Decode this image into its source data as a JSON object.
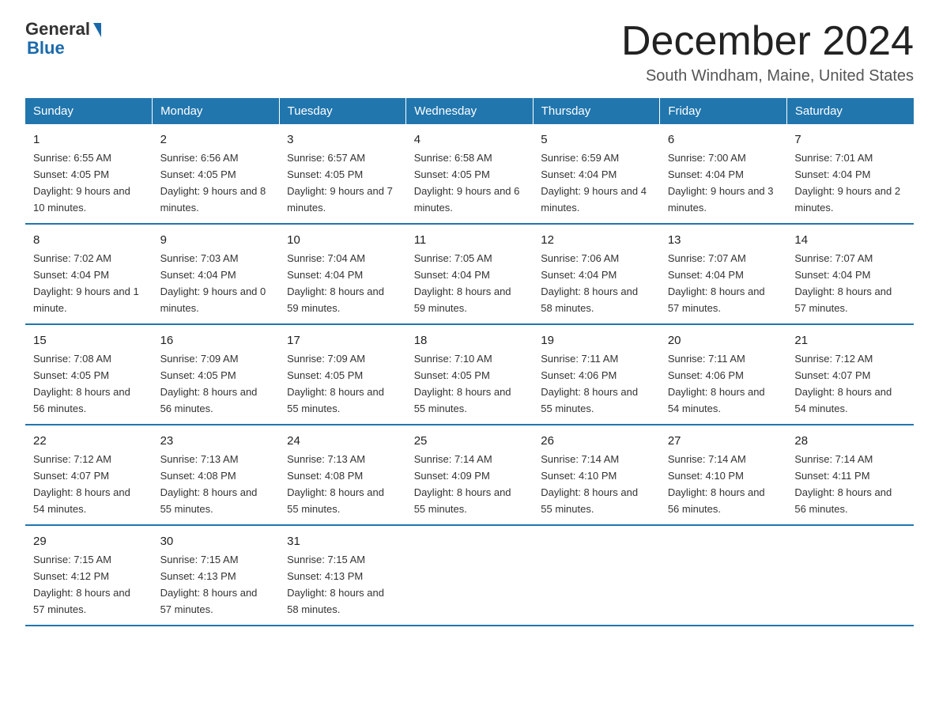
{
  "logo": {
    "general": "General",
    "blue": "Blue"
  },
  "title": "December 2024",
  "location": "South Windham, Maine, United States",
  "days_of_week": [
    "Sunday",
    "Monday",
    "Tuesday",
    "Wednesday",
    "Thursday",
    "Friday",
    "Saturday"
  ],
  "weeks": [
    [
      {
        "day": "1",
        "sunrise": "Sunrise: 6:55 AM",
        "sunset": "Sunset: 4:05 PM",
        "daylight": "Daylight: 9 hours and 10 minutes."
      },
      {
        "day": "2",
        "sunrise": "Sunrise: 6:56 AM",
        "sunset": "Sunset: 4:05 PM",
        "daylight": "Daylight: 9 hours and 8 minutes."
      },
      {
        "day": "3",
        "sunrise": "Sunrise: 6:57 AM",
        "sunset": "Sunset: 4:05 PM",
        "daylight": "Daylight: 9 hours and 7 minutes."
      },
      {
        "day": "4",
        "sunrise": "Sunrise: 6:58 AM",
        "sunset": "Sunset: 4:05 PM",
        "daylight": "Daylight: 9 hours and 6 minutes."
      },
      {
        "day": "5",
        "sunrise": "Sunrise: 6:59 AM",
        "sunset": "Sunset: 4:04 PM",
        "daylight": "Daylight: 9 hours and 4 minutes."
      },
      {
        "day": "6",
        "sunrise": "Sunrise: 7:00 AM",
        "sunset": "Sunset: 4:04 PM",
        "daylight": "Daylight: 9 hours and 3 minutes."
      },
      {
        "day": "7",
        "sunrise": "Sunrise: 7:01 AM",
        "sunset": "Sunset: 4:04 PM",
        "daylight": "Daylight: 9 hours and 2 minutes."
      }
    ],
    [
      {
        "day": "8",
        "sunrise": "Sunrise: 7:02 AM",
        "sunset": "Sunset: 4:04 PM",
        "daylight": "Daylight: 9 hours and 1 minute."
      },
      {
        "day": "9",
        "sunrise": "Sunrise: 7:03 AM",
        "sunset": "Sunset: 4:04 PM",
        "daylight": "Daylight: 9 hours and 0 minutes."
      },
      {
        "day": "10",
        "sunrise": "Sunrise: 7:04 AM",
        "sunset": "Sunset: 4:04 PM",
        "daylight": "Daylight: 8 hours and 59 minutes."
      },
      {
        "day": "11",
        "sunrise": "Sunrise: 7:05 AM",
        "sunset": "Sunset: 4:04 PM",
        "daylight": "Daylight: 8 hours and 59 minutes."
      },
      {
        "day": "12",
        "sunrise": "Sunrise: 7:06 AM",
        "sunset": "Sunset: 4:04 PM",
        "daylight": "Daylight: 8 hours and 58 minutes."
      },
      {
        "day": "13",
        "sunrise": "Sunrise: 7:07 AM",
        "sunset": "Sunset: 4:04 PM",
        "daylight": "Daylight: 8 hours and 57 minutes."
      },
      {
        "day": "14",
        "sunrise": "Sunrise: 7:07 AM",
        "sunset": "Sunset: 4:04 PM",
        "daylight": "Daylight: 8 hours and 57 minutes."
      }
    ],
    [
      {
        "day": "15",
        "sunrise": "Sunrise: 7:08 AM",
        "sunset": "Sunset: 4:05 PM",
        "daylight": "Daylight: 8 hours and 56 minutes."
      },
      {
        "day": "16",
        "sunrise": "Sunrise: 7:09 AM",
        "sunset": "Sunset: 4:05 PM",
        "daylight": "Daylight: 8 hours and 56 minutes."
      },
      {
        "day": "17",
        "sunrise": "Sunrise: 7:09 AM",
        "sunset": "Sunset: 4:05 PM",
        "daylight": "Daylight: 8 hours and 55 minutes."
      },
      {
        "day": "18",
        "sunrise": "Sunrise: 7:10 AM",
        "sunset": "Sunset: 4:05 PM",
        "daylight": "Daylight: 8 hours and 55 minutes."
      },
      {
        "day": "19",
        "sunrise": "Sunrise: 7:11 AM",
        "sunset": "Sunset: 4:06 PM",
        "daylight": "Daylight: 8 hours and 55 minutes."
      },
      {
        "day": "20",
        "sunrise": "Sunrise: 7:11 AM",
        "sunset": "Sunset: 4:06 PM",
        "daylight": "Daylight: 8 hours and 54 minutes."
      },
      {
        "day": "21",
        "sunrise": "Sunrise: 7:12 AM",
        "sunset": "Sunset: 4:07 PM",
        "daylight": "Daylight: 8 hours and 54 minutes."
      }
    ],
    [
      {
        "day": "22",
        "sunrise": "Sunrise: 7:12 AM",
        "sunset": "Sunset: 4:07 PM",
        "daylight": "Daylight: 8 hours and 54 minutes."
      },
      {
        "day": "23",
        "sunrise": "Sunrise: 7:13 AM",
        "sunset": "Sunset: 4:08 PM",
        "daylight": "Daylight: 8 hours and 55 minutes."
      },
      {
        "day": "24",
        "sunrise": "Sunrise: 7:13 AM",
        "sunset": "Sunset: 4:08 PM",
        "daylight": "Daylight: 8 hours and 55 minutes."
      },
      {
        "day": "25",
        "sunrise": "Sunrise: 7:14 AM",
        "sunset": "Sunset: 4:09 PM",
        "daylight": "Daylight: 8 hours and 55 minutes."
      },
      {
        "day": "26",
        "sunrise": "Sunrise: 7:14 AM",
        "sunset": "Sunset: 4:10 PM",
        "daylight": "Daylight: 8 hours and 55 minutes."
      },
      {
        "day": "27",
        "sunrise": "Sunrise: 7:14 AM",
        "sunset": "Sunset: 4:10 PM",
        "daylight": "Daylight: 8 hours and 56 minutes."
      },
      {
        "day": "28",
        "sunrise": "Sunrise: 7:14 AM",
        "sunset": "Sunset: 4:11 PM",
        "daylight": "Daylight: 8 hours and 56 minutes."
      }
    ],
    [
      {
        "day": "29",
        "sunrise": "Sunrise: 7:15 AM",
        "sunset": "Sunset: 4:12 PM",
        "daylight": "Daylight: 8 hours and 57 minutes."
      },
      {
        "day": "30",
        "sunrise": "Sunrise: 7:15 AM",
        "sunset": "Sunset: 4:13 PM",
        "daylight": "Daylight: 8 hours and 57 minutes."
      },
      {
        "day": "31",
        "sunrise": "Sunrise: 7:15 AM",
        "sunset": "Sunset: 4:13 PM",
        "daylight": "Daylight: 8 hours and 58 minutes."
      },
      {
        "day": "",
        "sunrise": "",
        "sunset": "",
        "daylight": ""
      },
      {
        "day": "",
        "sunrise": "",
        "sunset": "",
        "daylight": ""
      },
      {
        "day": "",
        "sunrise": "",
        "sunset": "",
        "daylight": ""
      },
      {
        "day": "",
        "sunrise": "",
        "sunset": "",
        "daylight": ""
      }
    ]
  ]
}
